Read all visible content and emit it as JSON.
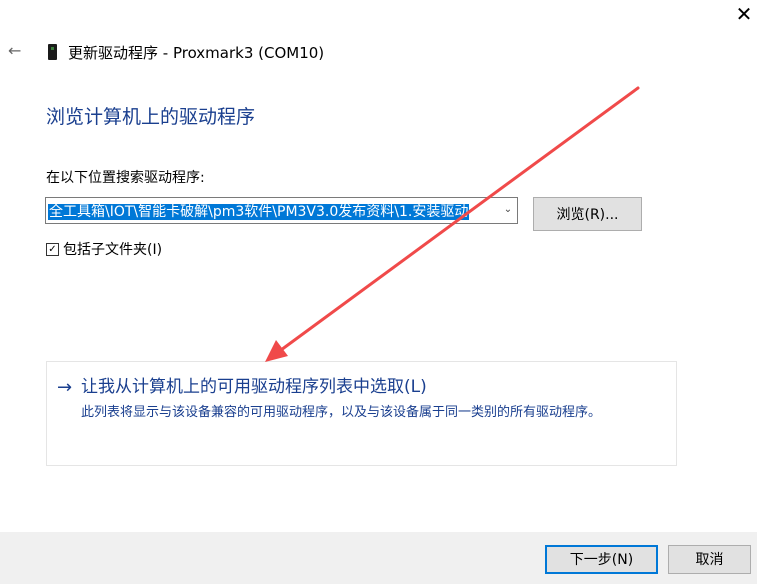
{
  "window": {
    "close_glyph": "✕",
    "back_glyph": "←",
    "title": "更新驱动程序 - Proxmark3 (COM10)"
  },
  "page": {
    "heading": "浏览计算机上的驱动程序",
    "location_label": "在以下位置搜索驱动程序:",
    "path_value": "全工具箱\\IOT\\智能卡破解\\pm3软件\\PM3V3.0发布资料\\1.安装驱动",
    "browse_label": "浏览(R)...",
    "include_subfolders_label": "包括子文件夹(I)",
    "include_subfolders_checked": true,
    "checkbox_glyph": "✓"
  },
  "pick_option": {
    "arrow_glyph": "→",
    "title": "让我从计算机上的可用驱动程序列表中选取(L)",
    "description": "此列表将显示与该设备兼容的可用驱动程序，以及与该设备属于同一类别的所有驱动程序。"
  },
  "footer": {
    "next_label": "下一步(N)",
    "cancel_label": "取消"
  },
  "colors": {
    "heading": "#1a3f8f",
    "selection": "#0078d7",
    "annotation_arrow": "#f04a4a",
    "footer_bg": "#f0f0f0"
  },
  "icons": {
    "device": "usb-device-icon",
    "back": "back-arrow-icon",
    "close": "close-icon",
    "dropdown": "chevron-down-icon"
  }
}
